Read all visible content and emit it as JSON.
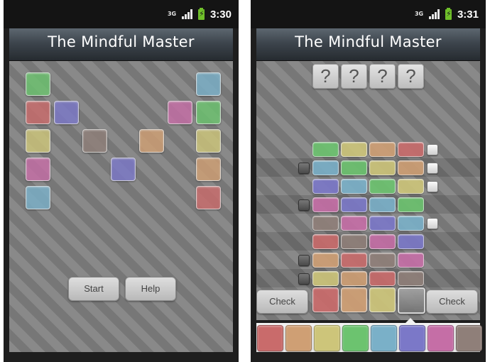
{
  "colors": {
    "red": "#c96b6b",
    "orange": "#cf9f74",
    "yellow": "#cdc57a",
    "green": "#6cc36f",
    "blue": "#7ab0c8",
    "purple": "#7b78c8",
    "pink": "#c56ea6",
    "brown": "#8f7f79",
    "gray": "#8a8a8a"
  },
  "left_screen": {
    "status": {
      "network": "3G",
      "time": "3:30"
    },
    "title": "The Mindful Master",
    "start_button": "Start",
    "help_button": "Help",
    "decorative_tiles": [
      {
        "color": "green"
      },
      {
        "color": "red"
      },
      {
        "color": "purple"
      },
      {
        "color": "yellow"
      },
      {
        "color": "pink"
      },
      {
        "color": "blue"
      },
      {
        "color": "brown"
      },
      {
        "color": "orange"
      },
      {
        "color": "purple"
      },
      {
        "color": "blue"
      },
      {
        "color": "pink"
      },
      {
        "color": "green"
      },
      {
        "color": "yellow"
      },
      {
        "color": "orange"
      },
      {
        "color": "red"
      }
    ]
  },
  "right_screen": {
    "status": {
      "network": "3G",
      "time": "3:31"
    },
    "title": "The Mindful Master",
    "secret_code": [
      "?",
      "?",
      "?",
      "?"
    ],
    "guess_rows": [
      {
        "pegs": [
          "green",
          "yellow",
          "orange",
          "red"
        ],
        "feedback": {
          "black": 0,
          "white": 1
        }
      },
      {
        "pegs": [
          "blue",
          "green",
          "yellow",
          "orange"
        ],
        "feedback": {
          "black": 1,
          "white": 1
        }
      },
      {
        "pegs": [
          "purple",
          "blue",
          "green",
          "yellow"
        ],
        "feedback": {
          "black": 0,
          "white": 1
        }
      },
      {
        "pegs": [
          "pink",
          "purple",
          "blue",
          "green"
        ],
        "feedback": {
          "black": 1,
          "white": 0
        }
      },
      {
        "pegs": [
          "brown",
          "pink",
          "purple",
          "blue"
        ],
        "feedback": {
          "black": 0,
          "white": 1
        }
      },
      {
        "pegs": [
          "red",
          "brown",
          "pink",
          "purple"
        ],
        "feedback": {
          "black": 0,
          "white": 0
        }
      },
      {
        "pegs": [
          "orange",
          "red",
          "brown",
          "pink"
        ],
        "feedback": {
          "black": 1,
          "white": 0
        }
      },
      {
        "pegs": [
          "yellow",
          "orange",
          "red",
          "brown"
        ],
        "feedback": {
          "black": 1,
          "white": 0
        }
      }
    ],
    "current_guess": [
      "red",
      "orange",
      "yellow",
      "gray"
    ],
    "check_left": "Check",
    "check_right": "Check",
    "palette": [
      "red",
      "orange",
      "yellow",
      "green",
      "blue",
      "purple",
      "pink",
      "brown"
    ]
  }
}
